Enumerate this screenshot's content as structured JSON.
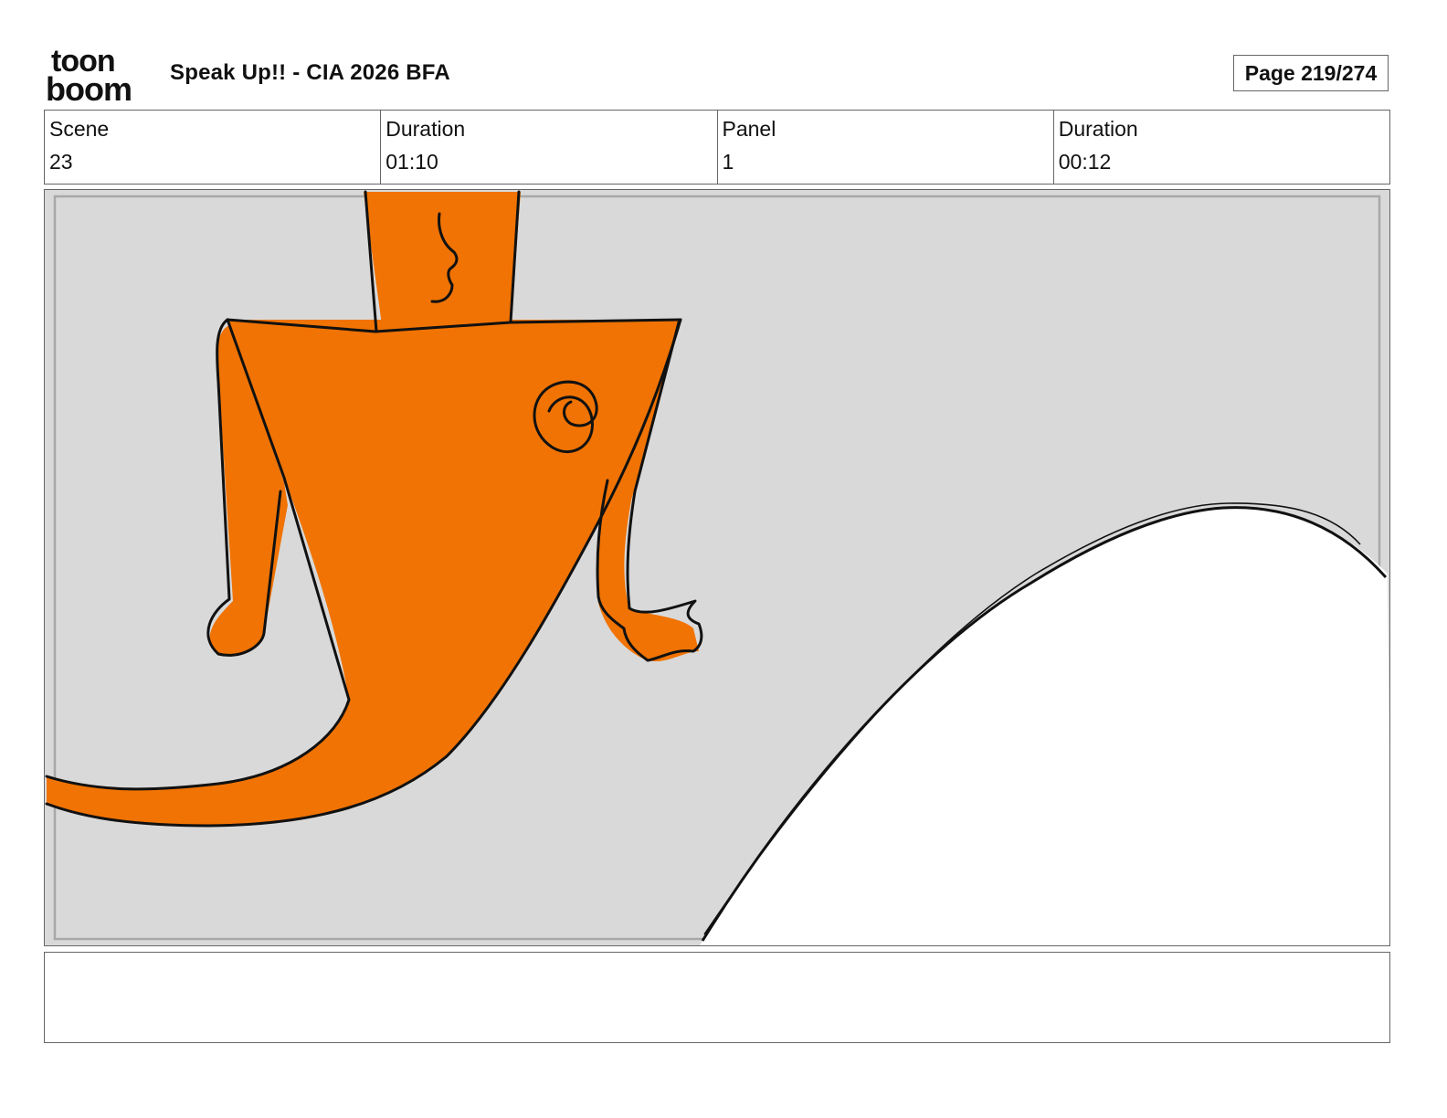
{
  "header": {
    "logo_text_top": "toon",
    "logo_text_bottom": "boom",
    "project_title": "Speak Up!! - CIA 2026 BFA",
    "page_label": "Page 219/274"
  },
  "info": {
    "scene_label": "Scene",
    "scene_value": "23",
    "scene_duration_label": "Duration",
    "scene_duration_value": "01:10",
    "panel_label": "Panel",
    "panel_value": "1",
    "panel_duration_label": "Duration",
    "panel_duration_value": "00:12"
  },
  "panel": {
    "background_color": "#d9d9d9",
    "character_color": "#f07303",
    "hill_color": "#ffffff",
    "line_color": "#111111"
  },
  "notes": {
    "text": ""
  }
}
